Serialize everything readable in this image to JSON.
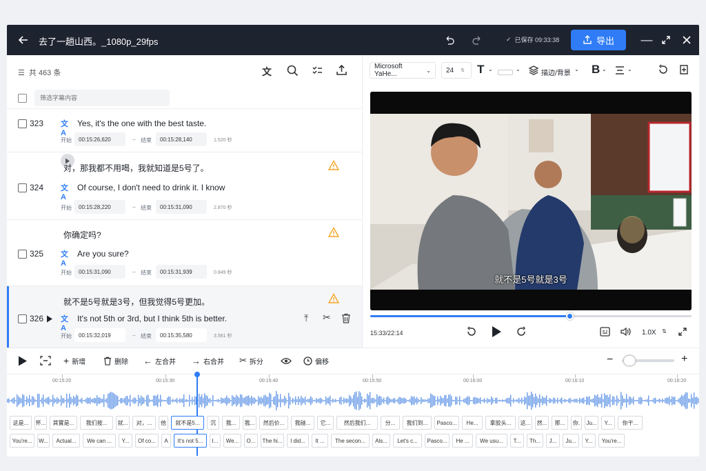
{
  "title": "去了一趟山西。_1080p_29fps",
  "saved": "已保存 09:33:38",
  "export_label": "导出",
  "left": {
    "count": "共 463 条",
    "filter_placeholder": "筛选字幕内容",
    "rows": [
      {
        "num": "323",
        "zh": "",
        "en": "Yes, it's the one with the best taste.",
        "start_label": "开始",
        "start": "00:15:26,620",
        "end_label": "结束",
        "end": "00:15:28,140",
        "dur": "1.520 秒",
        "warn": false
      },
      {
        "num": "324",
        "zh": "对，那我都不用喝，我就知道是5号了。",
        "en": "Of course, I don't need to drink it. I know",
        "start_label": "开始",
        "start": "00:15:28,220",
        "end_label": "结束",
        "end": "00:15:31,090",
        "dur": "2.870 秒",
        "warn": true
      },
      {
        "num": "325",
        "zh": "你确定吗?",
        "en": "Are you sure?",
        "start_label": "开始",
        "start": "00:15:31,090",
        "end_label": "结束",
        "end": "00:15:31,939",
        "dur": "0.849 秒",
        "warn": true
      },
      {
        "num": "326",
        "zh": "就不是5号就是3号，但我觉得5号更加。",
        "en": "It's not 5th or 3rd, but I think 5th is better.",
        "start_label": "开始",
        "start": "00:15:32,019",
        "end_label": "结束",
        "end": "00:15:35,580",
        "dur": "3.561 秒",
        "warn": true
      }
    ]
  },
  "right": {
    "font": "Microsoft YaHe...",
    "size": "24",
    "stroke_label": "描边/背景",
    "subtitle_overlay": "就不是5号就是3号",
    "time": "15:33/22:14",
    "speed": "1.0X",
    "progress": 0.62
  },
  "bottom": {
    "buttons": {
      "add": "新增",
      "delete": "删除",
      "merge_left": "左合并",
      "merge_right": "右合并",
      "split": "拆分",
      "offset": "偏移"
    },
    "ticks": [
      "00:15:20",
      "00:15:30",
      "00:15:40",
      "00:15:50",
      "00:16:00",
      "00:16:10",
      "00:16:20"
    ],
    "track1": [
      "这是...",
      "怀...",
      "其實是...",
      "我们按...",
      "就...",
      "对，...",
      "他",
      "就不是5...",
      "沉",
      "我...",
      "我...",
      "然后价...",
      "我碰...",
      "它...",
      "然后我们...",
      "分...",
      "我们到...",
      "Pasco...",
      "He...",
      "拿胶头...",
      "这...",
      "然...",
      "那...",
      "你.",
      "Ju...",
      "Y...",
      "你干..."
    ],
    "track2": [
      "You're...",
      "W...",
      "Actual...",
      "We can ...",
      "Y...",
      "Of co...",
      "A",
      "It's not 5...",
      "I...",
      "We...",
      "O...",
      "The hi...",
      "I did...",
      "It ...",
      "The secon...",
      "Als...",
      "Let's c...",
      "Pasco...",
      "He ...",
      "We usu...",
      "T...",
      "Th...",
      "J...",
      "Ju...",
      "Y...",
      "You're..."
    ]
  },
  "colors": {
    "accent": "#2f7cf6",
    "titlebar": "#1e2330",
    "warning": "#f5a524"
  }
}
